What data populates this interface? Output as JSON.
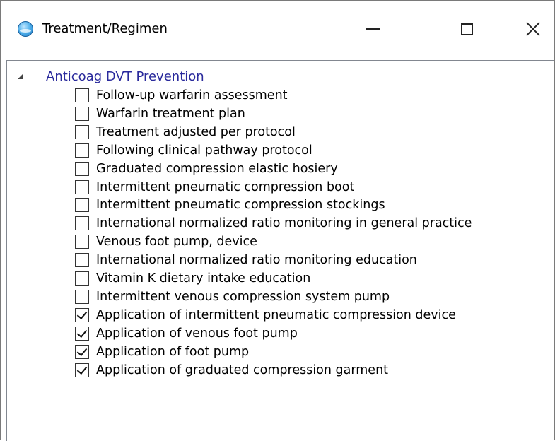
{
  "window": {
    "title": "Treatment/Regimen",
    "icon": "app-globe-icon"
  },
  "title_buttons": {
    "minimize": "minimize-icon",
    "maximize": "maximize-icon",
    "close": "close-icon"
  },
  "tree": {
    "root_label": "Anticoag DVT Prevention",
    "root_expanded": true,
    "items": [
      {
        "label": "Follow-up warfarin assessment",
        "checked": false
      },
      {
        "label": "Warfarin treatment plan",
        "checked": false
      },
      {
        "label": "Treatment adjusted per protocol",
        "checked": false
      },
      {
        "label": "Following clinical pathway protocol",
        "checked": false
      },
      {
        "label": "Graduated compression elastic hosiery",
        "checked": false
      },
      {
        "label": "Intermittent pneumatic compression boot",
        "checked": false
      },
      {
        "label": "Intermittent pneumatic compression stockings",
        "checked": false
      },
      {
        "label": "International normalized ratio monitoring in general practice",
        "checked": false
      },
      {
        "label": "Venous foot pump, device",
        "checked": false
      },
      {
        "label": "International normalized ratio monitoring education",
        "checked": false
      },
      {
        "label": "Vitamin K dietary intake education",
        "checked": false
      },
      {
        "label": "Intermittent venous compression system pump",
        "checked": false
      },
      {
        "label": "Application of intermittent pneumatic compression device",
        "checked": true
      },
      {
        "label": "Application of venous foot pump",
        "checked": true
      },
      {
        "label": "Application of foot pump",
        "checked": true
      },
      {
        "label": "Application of graduated compression garment",
        "checked": true
      }
    ]
  },
  "colors": {
    "root_label": "#2a2a9c",
    "border": "#828790"
  }
}
